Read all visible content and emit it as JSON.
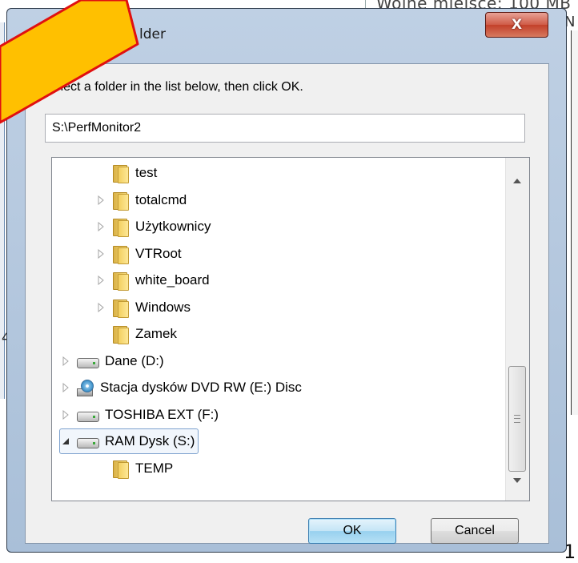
{
  "background": {
    "top_text": "Wolne miejsce: 100 MB",
    "right_fragment": "N",
    "left_fragment": "4",
    "bottom_fragment": "1"
  },
  "dialog": {
    "title": "lder",
    "close_label": "X",
    "instruction": "Select a folder in the list below, then click OK.",
    "path_value": "S:\\PerfMonitor2",
    "ok_label": "OK",
    "cancel_label": "Cancel"
  },
  "tree": {
    "items": [
      {
        "label": "test",
        "icon": "folder-icon",
        "expander": "none",
        "level": 2
      },
      {
        "label": "totalcmd",
        "icon": "folder-icon",
        "expander": "collapsed",
        "level": 2
      },
      {
        "label": "Użytkownicy",
        "icon": "folder-icon",
        "expander": "collapsed",
        "level": 2
      },
      {
        "label": "VTRoot",
        "icon": "folder-icon",
        "expander": "collapsed",
        "level": 2
      },
      {
        "label": "white_board",
        "icon": "folder-icon",
        "expander": "collapsed",
        "level": 2
      },
      {
        "label": "Windows",
        "icon": "folder-icon",
        "expander": "collapsed",
        "level": 2
      },
      {
        "label": "Zamek",
        "icon": "folder-icon",
        "expander": "none",
        "level": 2
      },
      {
        "label": "Dane (D:)",
        "icon": "drive-icon",
        "expander": "collapsed",
        "level": 1
      },
      {
        "label": "Stacja dysków DVD RW (E:) Disc",
        "icon": "dvd-icon",
        "expander": "collapsed",
        "level": 1
      },
      {
        "label": "TOSHIBA EXT (F:)",
        "icon": "drive-icon",
        "expander": "collapsed",
        "level": 1
      },
      {
        "label": "RAM Dysk (S:)",
        "icon": "drive-icon",
        "expander": "expanded",
        "level": 1,
        "selected": true
      },
      {
        "label": "TEMP",
        "icon": "folder-icon",
        "expander": "none",
        "level": 2
      }
    ]
  },
  "colors": {
    "arrow_fill": "#ffc000",
    "arrow_stroke": "#e01010",
    "selection_border": "#7da2ce"
  }
}
